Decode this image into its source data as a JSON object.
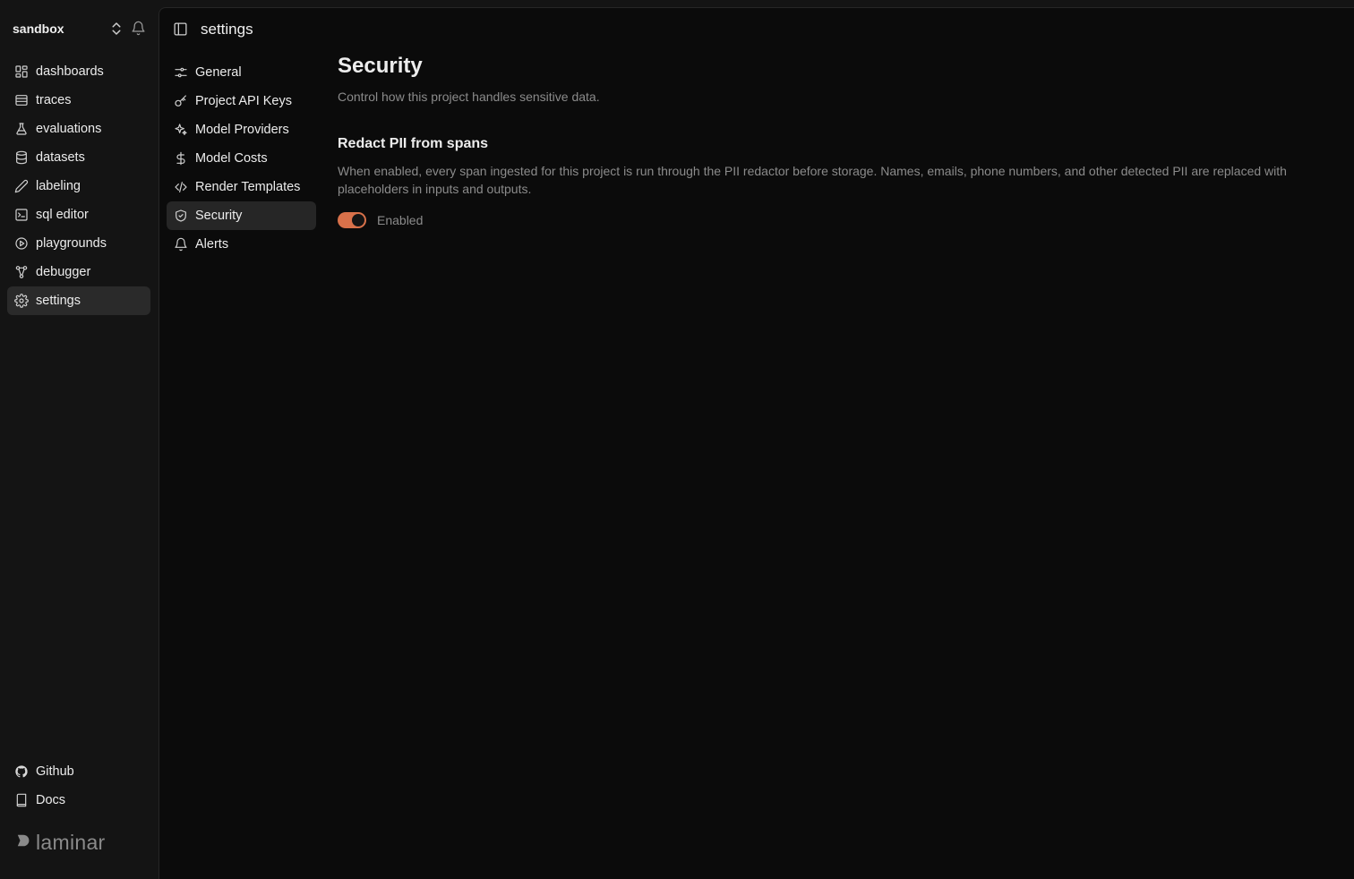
{
  "sidebar": {
    "project": "sandbox",
    "items": [
      {
        "label": "dashboards",
        "icon": "dashboard-icon"
      },
      {
        "label": "traces",
        "icon": "table-icon"
      },
      {
        "label": "evaluations",
        "icon": "flask-icon"
      },
      {
        "label": "datasets",
        "icon": "database-icon"
      },
      {
        "label": "labeling",
        "icon": "pen-icon"
      },
      {
        "label": "sql editor",
        "icon": "terminal-icon"
      },
      {
        "label": "playgrounds",
        "icon": "play-icon"
      },
      {
        "label": "debugger",
        "icon": "graph-icon"
      },
      {
        "label": "settings",
        "icon": "gear-icon",
        "active": true
      }
    ],
    "bottom": [
      {
        "label": "Github",
        "icon": "github-icon"
      },
      {
        "label": "Docs",
        "icon": "book-icon"
      }
    ],
    "logo_text": "laminar"
  },
  "header": {
    "title": "settings"
  },
  "settings_nav": {
    "items": [
      {
        "label": "General",
        "icon": "sliders-icon"
      },
      {
        "label": "Project API Keys",
        "icon": "key-icon"
      },
      {
        "label": "Model Providers",
        "icon": "sparkles-icon"
      },
      {
        "label": "Model Costs",
        "icon": "dollar-icon"
      },
      {
        "label": "Render Templates",
        "icon": "code-icon"
      },
      {
        "label": "Security",
        "icon": "shield-icon",
        "active": true
      },
      {
        "label": "Alerts",
        "icon": "bell-icon"
      }
    ]
  },
  "content": {
    "title": "Security",
    "subtitle": "Control how this project handles sensitive data.",
    "section_title": "Redact PII from spans",
    "section_desc": "When enabled, every span ingested for this project is run through the PII redactor before storage. Names, emails, phone numbers, and other detected PII are replaced with placeholders in inputs and outputs.",
    "toggle_label": "Enabled",
    "toggle_on": true
  },
  "colors": {
    "accent": "#d8714a",
    "sidebar_bg": "#141414",
    "main_bg": "#0b0b0b"
  }
}
